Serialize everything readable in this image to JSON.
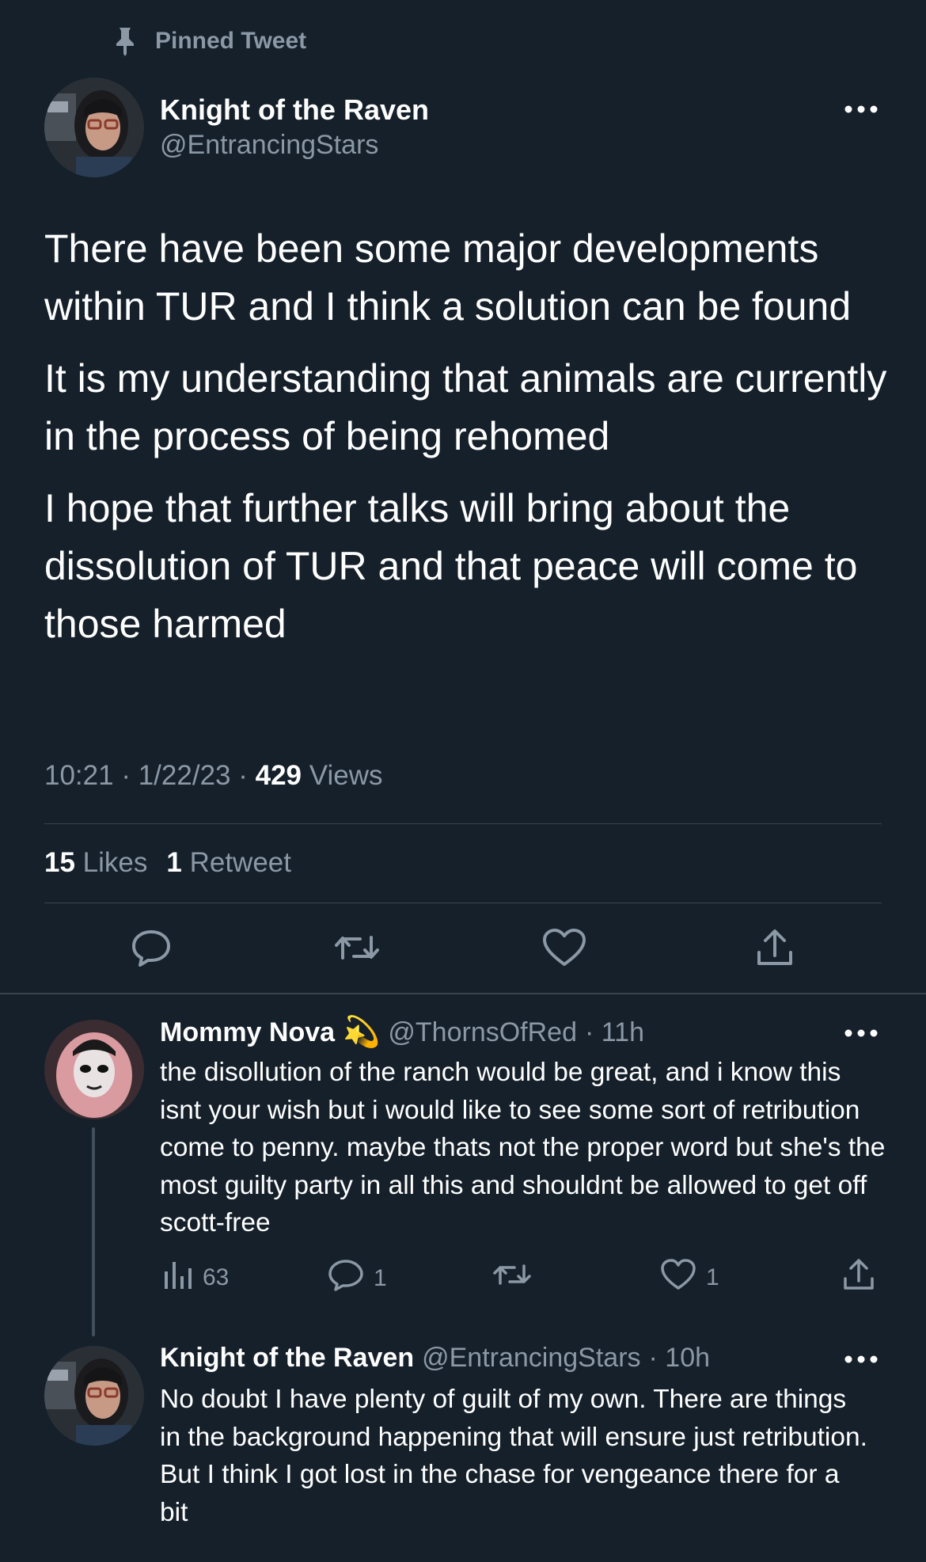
{
  "pinned": {
    "label": "Pinned Tweet"
  },
  "main_tweet": {
    "name": "Knight of the Raven",
    "handle": "@EntrancingStars",
    "paragraphs": [
      "There have been some major developments within TUR and I think a solution can be found",
      "It is my understanding that animals are currently in the process of being rehomed",
      "I hope that further talks will bring about the dissolution of TUR and that peace will come to those harmed"
    ],
    "time": "10:21",
    "date": "1/22/23",
    "views_count": "429",
    "views_label": "Views",
    "likes_count": "15",
    "likes_label": "Likes",
    "retweets_count": "1",
    "retweets_label": "Retweet"
  },
  "replies": [
    {
      "name": "Mommy Nova",
      "emoji": "💫",
      "handle": "@ThornsOfRed",
      "time": "· 11h",
      "text": "the disollution of the ranch would be great, and i know this isnt your wish but i would like to see some sort of retribution come to penny. maybe thats not the proper word but she's the most guilty party in all this and shouldnt be allowed to get off scott-free",
      "views": "63",
      "replies": "1",
      "likes": "1"
    },
    {
      "name": "Knight of the Raven",
      "handle": "@EntrancingStars",
      "time": "· 10h",
      "text": "No doubt I have plenty of guilt of my own. There are things in the background happening that will ensure just retribution. But I think I got lost in the chase for vengeance there for a bit"
    }
  ],
  "icons": {
    "pin": "pin-icon",
    "more": "more-icon",
    "reply": "reply-icon",
    "retweet": "retweet-icon",
    "like": "heart-icon",
    "share": "share-icon",
    "views": "views-icon"
  },
  "colors": {
    "background": "#15202b",
    "text": "#ffffff",
    "muted": "#8b98a5",
    "divider": "#38444d"
  }
}
